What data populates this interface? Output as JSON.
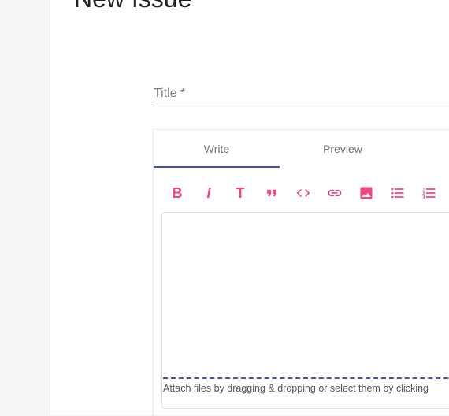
{
  "page": {
    "title": "New Issue"
  },
  "form": {
    "title_label": "Title *"
  },
  "editor": {
    "tabs": [
      {
        "label": "Write",
        "active": true
      },
      {
        "label": "Preview",
        "active": false
      }
    ],
    "toolbar": {
      "bold_label": "B",
      "italic_label": "I",
      "heading_label": "T",
      "items": [
        "bold-icon",
        "italic-icon",
        "heading-icon",
        "quote-icon",
        "code-icon",
        "link-icon",
        "image-icon",
        "bullet-list-icon",
        "numbered-list-icon"
      ]
    },
    "attach_text": "Attach files by dragging & dropping or select them by clicking",
    "accent_color": "#f0457f",
    "tab_indicator_color": "#3f51b5"
  }
}
